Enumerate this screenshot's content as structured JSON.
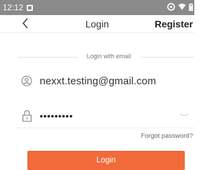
{
  "status_bar": {
    "time": "12:12",
    "icons": [
      "notification-icon",
      "vpn-icon",
      "wifi-icon",
      "battery-icon"
    ]
  },
  "header": {
    "title": "Login",
    "register_label": "Register",
    "back_icon": "chevron-left-icon"
  },
  "form": {
    "section_label": "Login with email",
    "email": {
      "icon": "user-icon",
      "value": "nexxt.testing@gmail.com"
    },
    "password": {
      "icon": "lock-icon",
      "value": "•••••••••",
      "toggle_icon": "eye-closed-icon"
    },
    "forgot_label": "Forgot password?"
  },
  "actions": {
    "login_label": "Login"
  },
  "colors": {
    "accent": "#f06a3a",
    "status_bar": "#8a8a8a"
  }
}
